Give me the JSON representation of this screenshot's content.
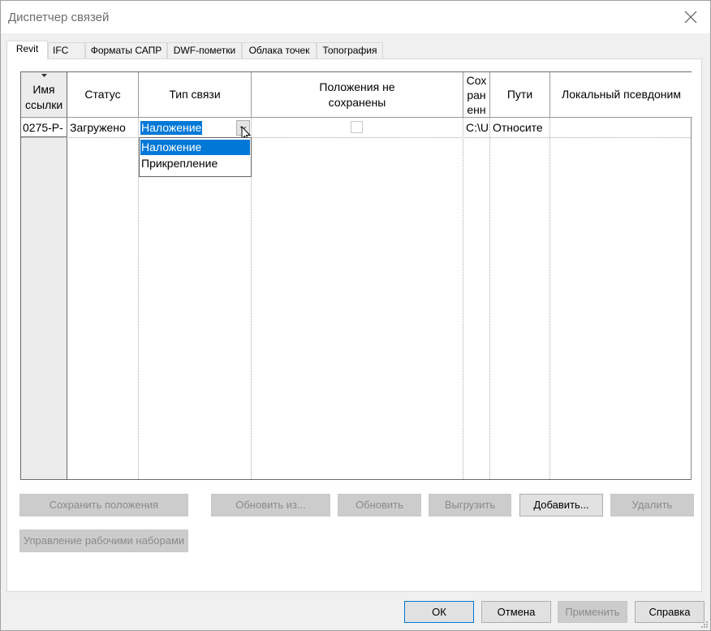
{
  "window": {
    "title": "Диспетчер связей"
  },
  "tabs": [
    {
      "label": "Revit",
      "active": true
    },
    {
      "label": "IFC"
    },
    {
      "label": "Форматы САПР"
    },
    {
      "label": "DWF-пометки"
    },
    {
      "label": "Облака точек"
    },
    {
      "label": "Топография"
    }
  ],
  "table": {
    "headers": {
      "name": "Имя ссылки",
      "status": "Статус",
      "type": "Тип связи",
      "positions": "Положения не сохранены",
      "saved": "Сох ран енн",
      "paths": "Пути",
      "alias": "Локальный псевдоним"
    },
    "rows": [
      {
        "name": "0275-P-",
        "status": "Загружено",
        "type": "Наложение",
        "saved": "C:\\U",
        "paths": "Относите"
      }
    ]
  },
  "dropdown": {
    "options": [
      "Наложение",
      "Прикрепление"
    ],
    "selected": "Наложение"
  },
  "buttons": {
    "save_positions": "Сохранить положения",
    "reload_from": "Обновить из...",
    "reload": "Обновить",
    "unload": "Выгрузить",
    "add": "Добавить...",
    "remove": "Удалить",
    "manage_worksets": "Управление рабочими наборами",
    "ok": "ОК",
    "cancel": "Отмена",
    "apply": "Применить",
    "help": "Справка"
  },
  "colors": {
    "selection": "#0078d7",
    "disabled_button": "#cccccc",
    "disabled_text": "#8a8a8a"
  }
}
